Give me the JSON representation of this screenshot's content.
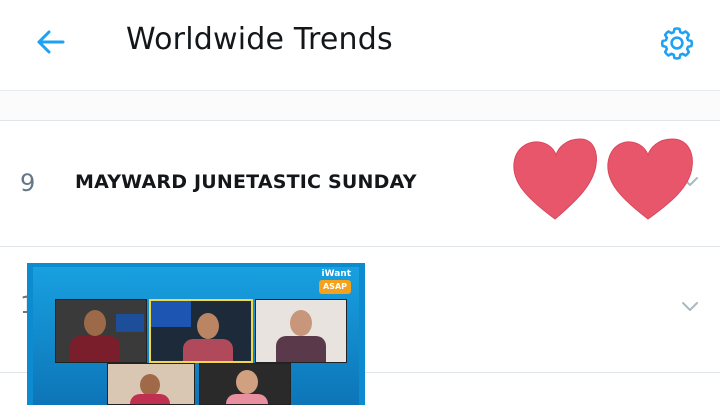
{
  "header": {
    "title": "Worldwide Trends",
    "back_icon": "arrow-left-icon",
    "settings_icon": "gear-icon",
    "accent_color": "#1da1f2"
  },
  "trends": [
    {
      "rank": "9",
      "name": "MAYWARD JUNETASTIC SUNDAY"
    },
    {
      "rank": "1"
    }
  ],
  "overlays": {
    "hearts_color": "#e8566c",
    "video_brand": "iWant",
    "video_logo": "ASAP"
  }
}
